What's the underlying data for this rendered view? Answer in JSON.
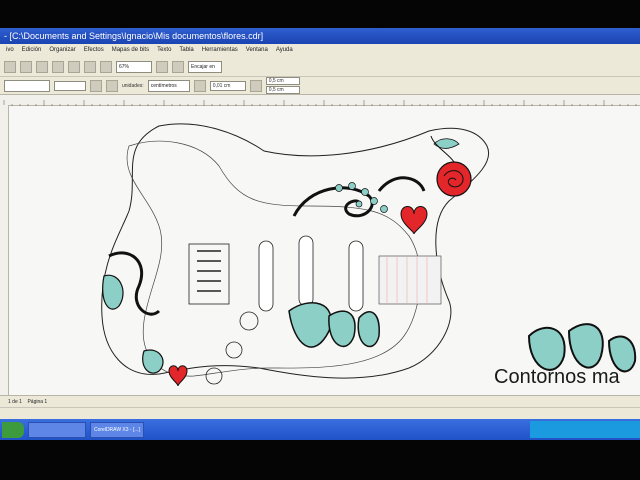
{
  "window": {
    "title": "- [C:\\Documents and Settings\\Ignacio\\Mis documentos\\flores.cdr]"
  },
  "menu": {
    "items": [
      "ivo",
      "Edición",
      "Organizar",
      "Efectos",
      "Mapas de bits",
      "Texto",
      "Tabla",
      "Herramientas",
      "Ventana",
      "Ayuda"
    ]
  },
  "toolbar": {
    "zoom": "67%",
    "snap": "Encajar en"
  },
  "propbar": {
    "x": "0,5 cm",
    "y": "0,5 cm",
    "units": "unidades:",
    "units_value": "centímetros",
    "nudge": "0,01 cm"
  },
  "canvas": {
    "overlay_text": "Contornos ma",
    "colors": {
      "teal": "#8ccfc6",
      "red": "#e2262a",
      "outline": "#111111"
    }
  },
  "pagebar": {
    "label": "1 de 1",
    "page": "Página 1"
  },
  "taskbar": {
    "items": [
      "CorelDRAW X3 - [...]"
    ]
  }
}
